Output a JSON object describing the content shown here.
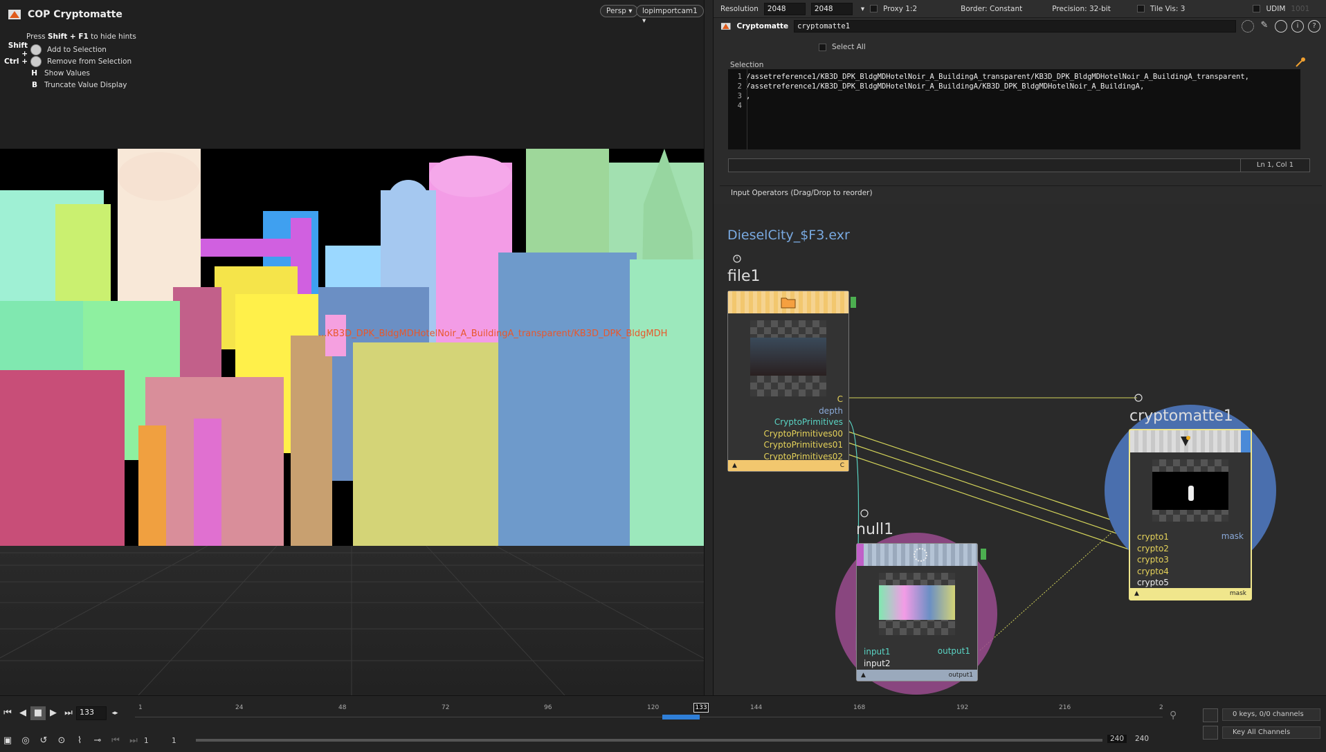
{
  "viewport": {
    "title": "COP Cryptomatte",
    "hint_header_prefix": "Press ",
    "hint_header_keys": "Shift + F1",
    "hint_header_suffix": " to hide hints",
    "hints": [
      {
        "key": "Shift +",
        "label": "Add to Selection",
        "mouse": true
      },
      {
        "key": "Ctrl +",
        "label": "Remove from Selection",
        "mouse": true
      },
      {
        "key": "H",
        "label": "Show Values",
        "mouse": false
      },
      {
        "key": "B",
        "label": "Truncate Value Display",
        "mouse": false
      }
    ],
    "camera_menu": "Persp ▾",
    "camera_name": "lopimportcam1 ▾",
    "hover_label": "...KB3D_DPK_BldgMDHotelNoir_A_BuildingA_transparent/KB3D_DPK_BldgMDH"
  },
  "params": {
    "resolution_label": "Resolution",
    "res_x": "2048",
    "res_y": "2048",
    "proxy_label": "Proxy 1:2",
    "border_label": "Border: Constant",
    "precision_label": "Precision: 32-bit",
    "tilevis_label": "Tile Vis: 3",
    "udim_label": "UDIM",
    "udim_value": "1001",
    "node_type": "Cryptomatte",
    "node_name": "cryptomatte1",
    "select_all": "Select All",
    "selection_label": "Selection",
    "code_lines": [
      {
        "n": "1",
        "text": "/assetreference1/KB3D_DPK_BldgMDHotelNoir_A_BuildingA_transparent/KB3D_DPK_BldgMDHotelNoir_A_BuildingA_transparent,"
      },
      {
        "n": "2",
        "text": "/assetreference1/KB3D_DPK_BldgMDHotelNoir_A_BuildingA/KB3D_DPK_BldgMDHotelNoir_A_BuildingA,"
      },
      {
        "n": "3",
        "text": ","
      },
      {
        "n": "4",
        "text": ""
      }
    ],
    "cursor_pos": "Ln 1, Col 1",
    "input_ops": "Input Operators (Drag/Drop to reorder)"
  },
  "network": {
    "file_path": "DieselCity_$F3.exr",
    "file_node": {
      "name": "file1",
      "outputs": [
        "C",
        "depth",
        "CryptoPrimitives",
        "CryptoPrimitives00",
        "CryptoPrimitives01",
        "CryptoPrimitives02"
      ],
      "footer": "C"
    },
    "null_node": {
      "name": "null1",
      "inputs": [
        "input1",
        "input2"
      ],
      "output": "output1",
      "footer": "output1"
    },
    "crypto_node": {
      "name": "cryptomatte1",
      "inputs": [
        "crypto1",
        "crypto2",
        "crypto3",
        "crypto4",
        "crypto5"
      ],
      "output": "mask",
      "footer": "mask"
    }
  },
  "timeline": {
    "current_frame": "133",
    "ticks": [
      "1",
      "24",
      "48",
      "72",
      "96",
      "120",
      "144",
      "168",
      "192",
      "216",
      "2"
    ],
    "marker": "133",
    "start": "1",
    "start2": "1",
    "end": "240",
    "end2": "240",
    "keys_info": "0 keys, 0/0 channels",
    "key_all": "Key All Channels"
  },
  "colors": {
    "file_node": "#f2c76e",
    "null_node": "#9aa9bc",
    "crypto_node": "#f0e68c",
    "wire_yellow": "#d4d45a",
    "wire_cyan": "#5ad4c4",
    "crypto_disc": "#4a6fae",
    "null_disc": "#9a4b8e"
  }
}
